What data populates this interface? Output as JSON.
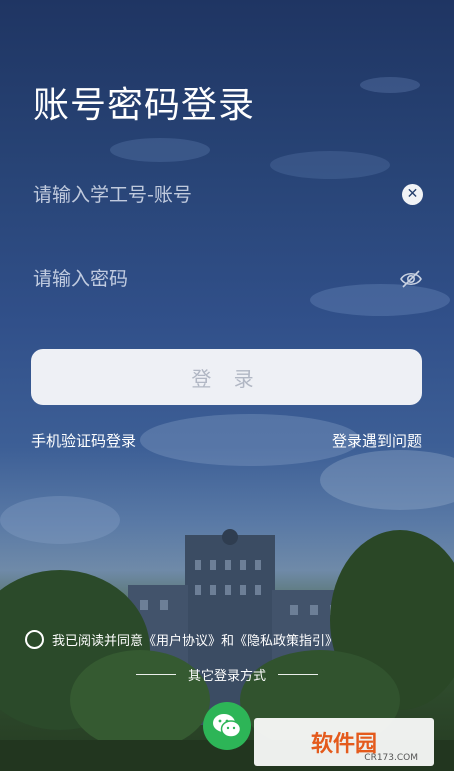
{
  "page": {
    "title": "账号密码登录"
  },
  "account": {
    "placeholder": "请输入学工号-账号"
  },
  "password": {
    "placeholder": "请输入密码"
  },
  "login_button": "登 录",
  "links": {
    "sms_login": "手机验证码登录",
    "trouble": "登录遇到问题"
  },
  "agreement": {
    "text": "我已阅读并同意《用户协议》和《隐私政策指引》"
  },
  "other_login": {
    "label": "其它登录方式"
  },
  "watermark": {
    "text": "软件园",
    "sub": "CR173.COM"
  }
}
